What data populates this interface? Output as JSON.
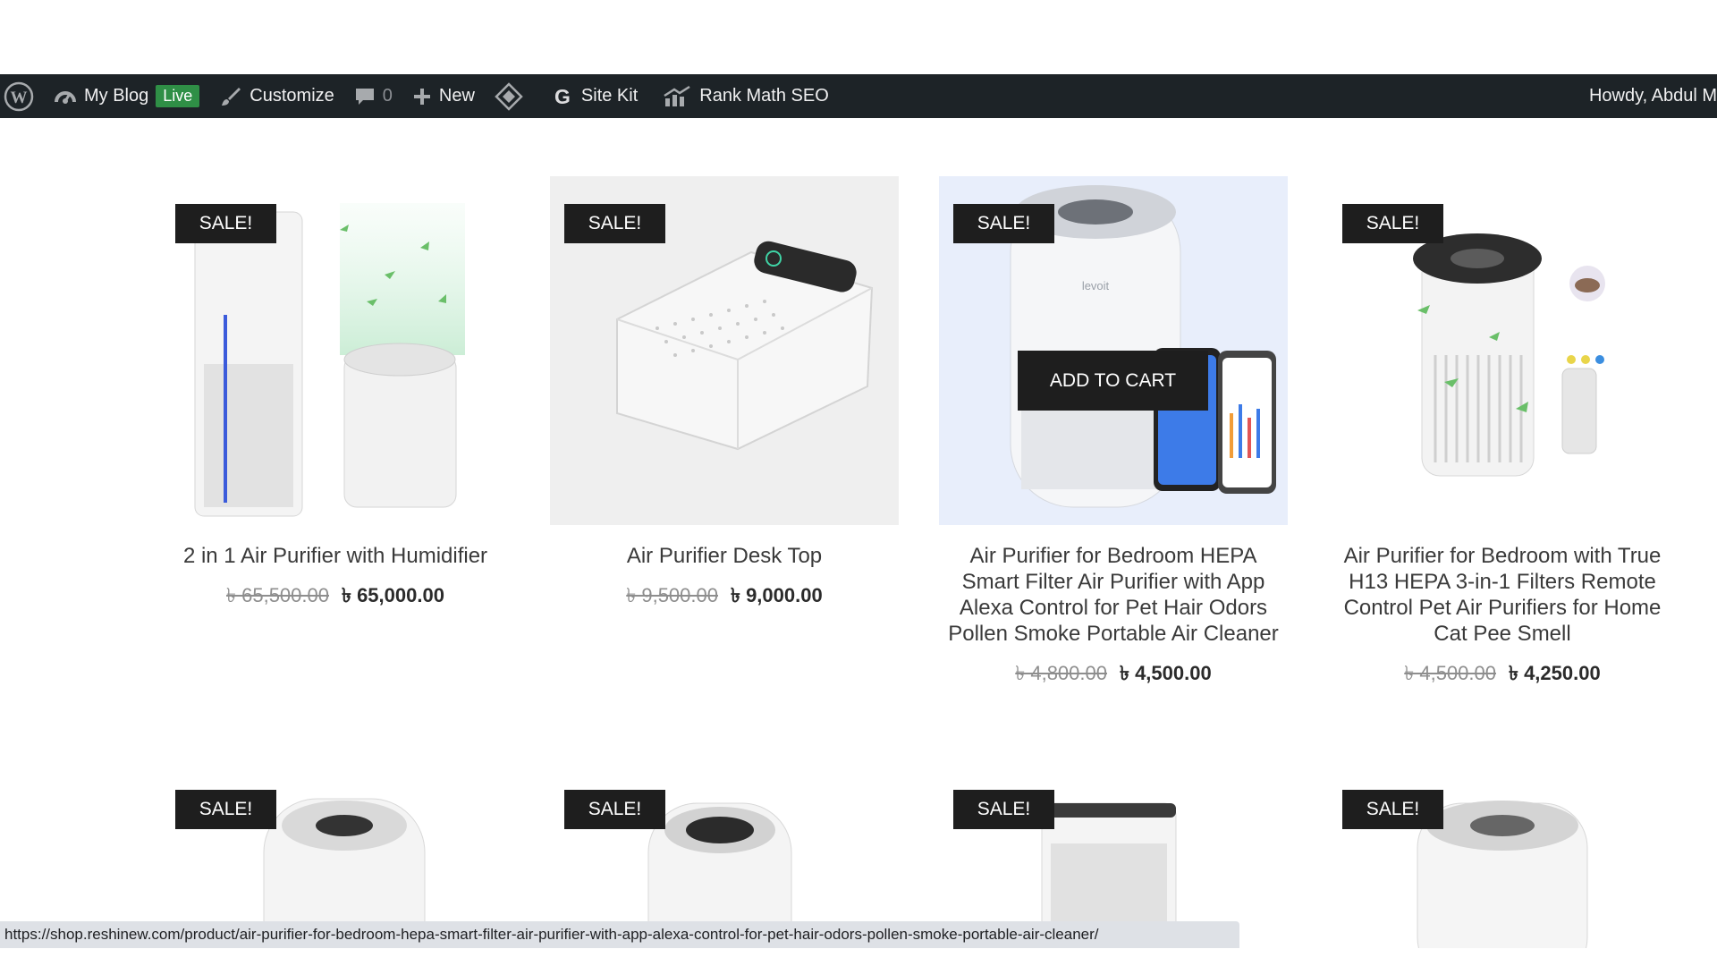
{
  "admin_bar": {
    "site_name": "My Blog",
    "live_badge": "Live",
    "customize": "Customize",
    "comments_count": "0",
    "new": "New",
    "site_kit": "Site Kit",
    "rank_math": "Rank Math SEO",
    "howdy": "Howdy, Abdul M"
  },
  "products": [
    {
      "badge": "SALE!",
      "title": "2 in 1 Air Purifier with Humidifier",
      "old_price": "৳ 65,500.00",
      "new_price": "৳ 65,000.00"
    },
    {
      "badge": "SALE!",
      "title": "Air Purifier Desk Top",
      "old_price": "৳ 9,500.00",
      "new_price": "৳ 9,000.00"
    },
    {
      "badge": "SALE!",
      "title": "Air Purifier for Bedroom HEPA Smart Filter Air Purifier with App Alexa Control for Pet Hair Odors Pollen Smoke Portable Air Cleaner",
      "old_price": "৳ 4,800.00",
      "new_price": "৳ 4,500.00",
      "add_to_cart": "ADD TO CART",
      "brand": "levoit"
    },
    {
      "badge": "SALE!",
      "title": "Air Purifier for Bedroom with True H13 HEPA 3-in-1 Filters Remote Control Pet Air Purifiers for Home Cat Pee Smell",
      "old_price": "৳ 4,500.00",
      "new_price": "৳ 4,250.00"
    }
  ],
  "row2_badges": [
    "SALE!",
    "SALE!",
    "SALE!",
    "SALE!"
  ],
  "status_url": "https://shop.reshinew.com/product/air-purifier-for-bedroom-hepa-smart-filter-air-purifier-with-app-alexa-control-for-pet-hair-odors-pollen-smoke-portable-air-cleaner/",
  "colors": {
    "admin_bar": "#1d2327",
    "badge": "#1e1e1e",
    "live": "#2f8f46"
  }
}
